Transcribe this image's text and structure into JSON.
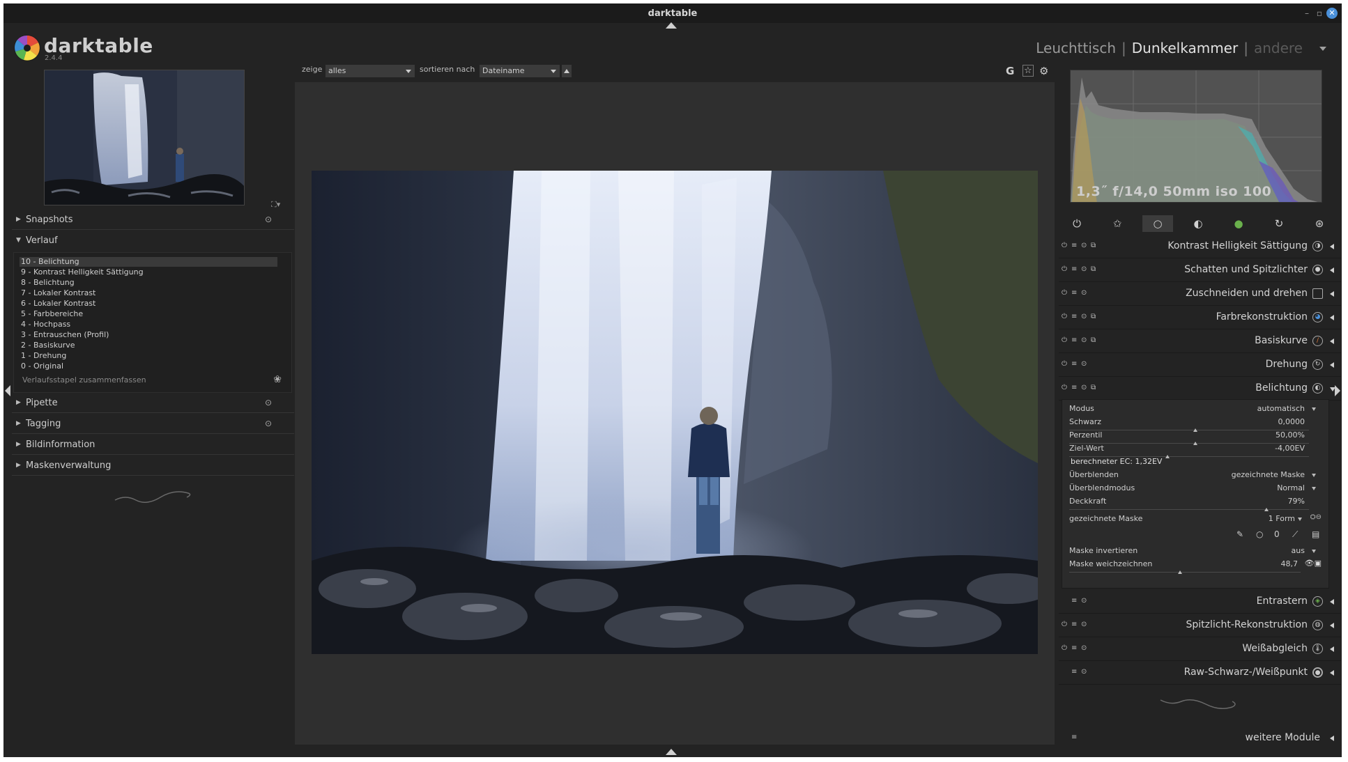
{
  "window": {
    "title": "darktable"
  },
  "app": {
    "name": "darktable",
    "version": "2.4.4"
  },
  "views": {
    "lighttable": "Leuchttisch",
    "darkroom": "Dunkelkammer",
    "other": "andere",
    "separator": "|"
  },
  "filter": {
    "show_label": "zeige",
    "show_value": "alles",
    "sort_label": "sortieren nach",
    "sort_value": "Dateiname",
    "top_icons": [
      "G",
      "☆",
      "⚙"
    ]
  },
  "left_panel": {
    "sections": [
      {
        "label": "Snapshots",
        "expanded": false
      },
      {
        "label": "Verlauf",
        "expanded": true
      },
      {
        "label": "Pipette",
        "expanded": false
      },
      {
        "label": "Tagging",
        "expanded": false
      },
      {
        "label": "Bildinformation",
        "expanded": false
      },
      {
        "label": "Maskenverwaltung",
        "expanded": false
      }
    ],
    "history": [
      "10 - Belichtung",
      "9 - Kontrast Helligkeit Sättigung",
      "8 - Belichtung",
      "7 - Lokaler Kontrast",
      "6 - Lokaler Kontrast",
      "5 - Farbbereiche",
      "4 - Hochpass",
      "3 - Entrauschen (Profil)",
      "2 - Basiskurve",
      "1 - Drehung",
      "0 - Original"
    ],
    "history_selected": 0,
    "compress_label": "Verlaufsstapel zusammenfassen"
  },
  "histogram": {
    "exif": "1,3˝ f/14,0 50mm iso 100"
  },
  "modules": [
    {
      "name": "Kontrast Helligkeit Sättigung",
      "icon": "contrast-icon"
    },
    {
      "name": "Schatten und Spitzlichter",
      "icon": "shadows-icon"
    },
    {
      "name": "Zuschneiden und drehen",
      "icon": "crop-icon"
    },
    {
      "name": "Farbrekonstruktion",
      "icon": "color-reconstruction-icon"
    },
    {
      "name": "Basiskurve",
      "icon": "curve-icon"
    },
    {
      "name": "Drehung",
      "icon": "rotate-icon"
    },
    {
      "name": "Belichtung",
      "icon": "exposure-icon",
      "expanded": true
    },
    {
      "name": "Entrastern",
      "icon": "demosaic-icon"
    },
    {
      "name": "Spitzlicht-Rekonstruktion",
      "icon": "highlight-icon"
    },
    {
      "name": "Weißabgleich",
      "icon": "white-balance-icon"
    },
    {
      "name": "Raw-Schwarz-/Weißpunkt",
      "icon": "rawpoint-icon"
    }
  ],
  "exposure": {
    "modus_label": "Modus",
    "modus_value": "automatisch",
    "schwarz_label": "Schwarz",
    "schwarz_value": "0,0000",
    "schwarz_level": 0.5,
    "perzentil_label": "Perzentil",
    "perzentil_value": "50,00%",
    "perzentil_level": 0.5,
    "ziel_label": "Ziel-Wert",
    "ziel_value": "-4,00EV",
    "ziel_level": 0.38,
    "computed_ec": "berechneter EC: 1,32EV",
    "blend_label": "Überblenden",
    "blend_value": "gezeichnete Maske",
    "blendmode_label": "Überblendmodus",
    "blendmode_value": "Normal",
    "opacity_label": "Deckkraft",
    "opacity_value": "79%",
    "opacity_level": 0.79,
    "drawn_mask_label": "gezeichnete Maske",
    "drawn_mask_value": "1 Form",
    "invert_label": "Maske invertieren",
    "invert_value": "aus",
    "feather_label": "Maske weichzeichnen",
    "feather_value": "48,7",
    "feather_level": 0.487
  },
  "more_modules": "weitere Module",
  "colors": {
    "accent": "#4a90d9",
    "panel": "#232323",
    "center": "#2f2f2f"
  }
}
